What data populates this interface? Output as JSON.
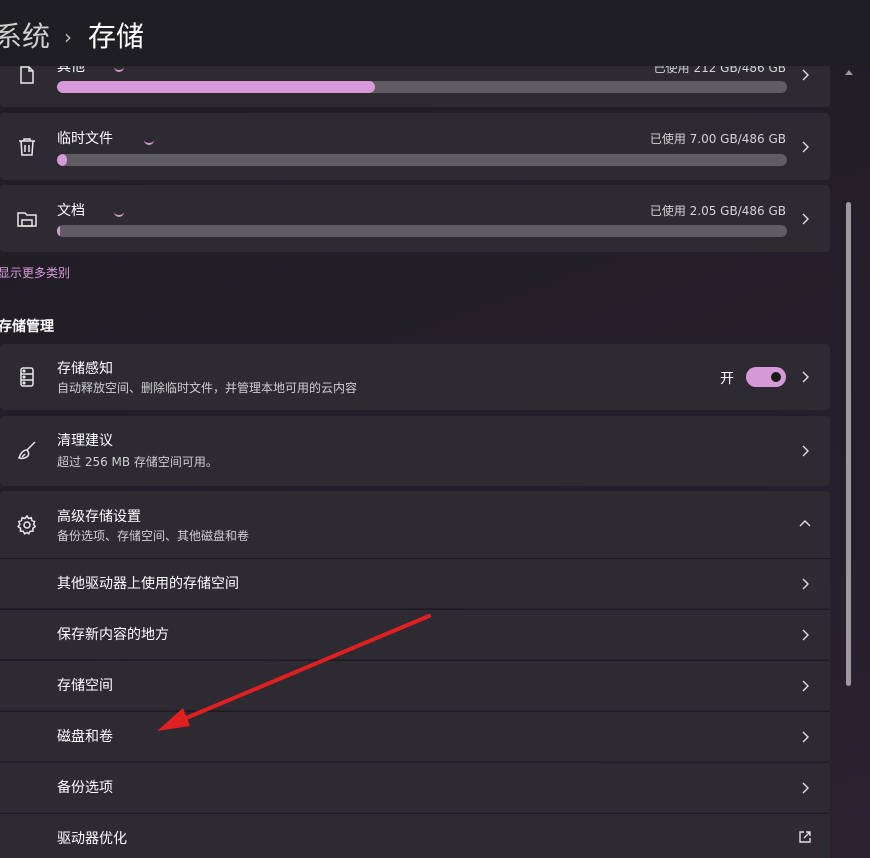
{
  "header": {
    "breadcrumb_parent": "系统",
    "breadcrumb_separator": "›",
    "breadcrumb_current": "存储"
  },
  "categories": [
    {
      "title": "其他",
      "usage": "已使用 212 GB/486 GB",
      "fill_percent": 43.6
    },
    {
      "title": "临时文件",
      "usage": "已使用 7.00 GB/486 GB",
      "fill_percent": 1.4
    },
    {
      "title": "文档",
      "usage": "已使用 2.05 GB/486 GB",
      "fill_percent": 0.4
    }
  ],
  "show_more_link": "显示更多类别",
  "management": {
    "section_title": "存储管理",
    "storage_sense": {
      "title": "存储感知",
      "subtitle": "自动释放空间、删除临时文件，并管理本地可用的云内容",
      "toggle_label": "开",
      "toggle_on": true
    },
    "cleanup": {
      "title": "清理建议",
      "subtitle": "超过 256 MB 存储空间可用。"
    },
    "advanced": {
      "title": "高级存储设置",
      "subtitle": "备份选项、存储空间、其他磁盘和卷",
      "expanded": true,
      "items": [
        {
          "title": "其他驱动器上使用的存储空间"
        },
        {
          "title": "保存新内容的地方"
        },
        {
          "title": "存储空间"
        },
        {
          "title": "磁盘和卷"
        },
        {
          "title": "备份选项"
        },
        {
          "title": "驱动器优化"
        }
      ]
    }
  },
  "colors": {
    "accent": "#d69ad9",
    "card": "#2d2a32",
    "annotation_arrow": "#e02020"
  }
}
